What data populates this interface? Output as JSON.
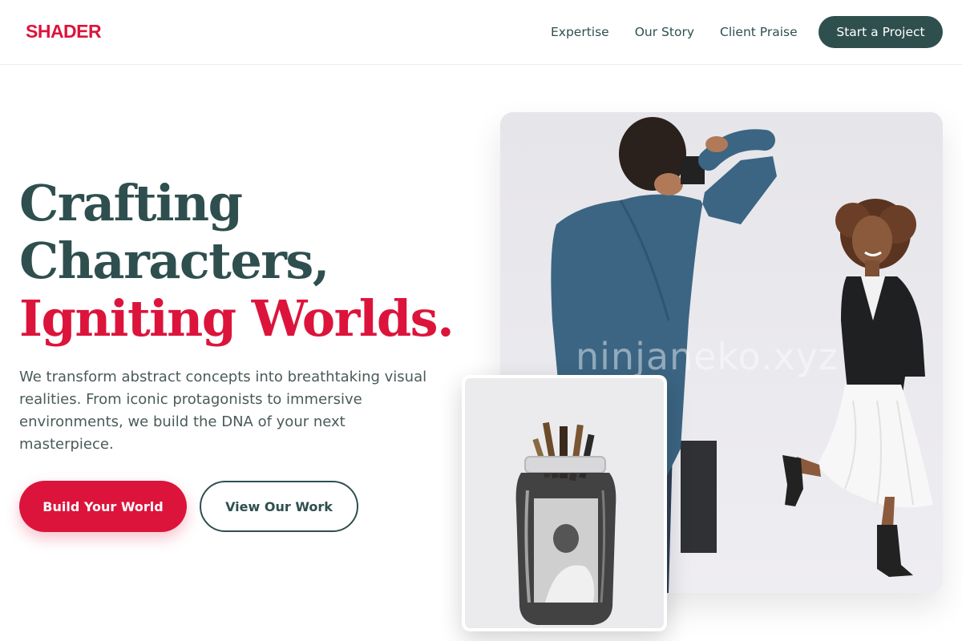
{
  "header": {
    "logo": "SHADER",
    "nav": [
      {
        "label": "Expertise"
      },
      {
        "label": "Our Story"
      },
      {
        "label": "Client Praise"
      }
    ],
    "cta": "Start a Project"
  },
  "hero": {
    "headline_line1": "Crafting",
    "headline_line2": "Characters,",
    "headline_accent": "Igniting Worlds.",
    "subtext": "We transform abstract concepts into breathtaking visual realities. From iconic protagonists to immersive environments, we build the DNA of your next masterpiece.",
    "primary_button": "Build Your World",
    "secondary_button": "View Our Work"
  },
  "images": {
    "watermark": "ninjaneko.xyz"
  },
  "colors": {
    "brand_red": "#dc143c",
    "dark_slate": "#2f4f4f"
  }
}
